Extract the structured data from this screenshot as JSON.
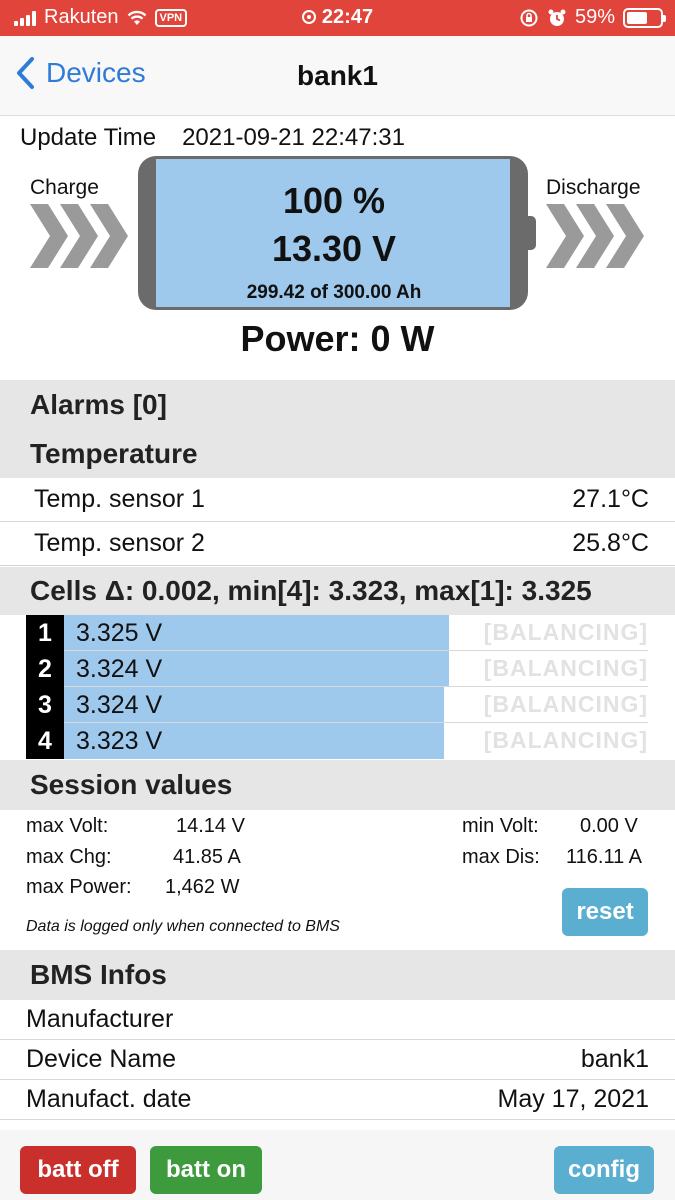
{
  "status_bar": {
    "carrier": "Rakuten",
    "vpn": "VPN",
    "time": "22:47",
    "battery_pct": "59%"
  },
  "nav": {
    "back_label": "Devices",
    "title": "bank1"
  },
  "battery": {
    "update_label": "Update Time",
    "update_value": "2021-09-21 22:47:31",
    "charge_label": "Charge",
    "discharge_label": "Discharge",
    "percent": "100 %",
    "voltage": "13.30 V",
    "capacity": "299.42 of 300.00 Ah",
    "power": "Power: 0 W",
    "fill_fraction": 1.0
  },
  "alarms": {
    "title": "Alarms [0]"
  },
  "temperature": {
    "title": "Temperature",
    "sensors": [
      {
        "label": "Temp. sensor 1",
        "value": "27.1°C"
      },
      {
        "label": "Temp. sensor 2",
        "value": "25.8°C"
      }
    ]
  },
  "cells": {
    "title": "Cells Δ: 0.002, min[4]: 3.323, max[1]: 3.325",
    "items": [
      {
        "num": "1",
        "voltage": "3.325 V",
        "status": "[BALANCING]",
        "level": 0.66
      },
      {
        "num": "2",
        "voltage": "3.324 V",
        "status": "[BALANCING]",
        "level": 0.66
      },
      {
        "num": "3",
        "voltage": "3.324 V",
        "status": "[BALANCING]",
        "level": 0.65
      },
      {
        "num": "4",
        "voltage": "3.323 V",
        "status": "[BALANCING]",
        "level": 0.65
      }
    ]
  },
  "session": {
    "title": "Session values",
    "max_volt_label": "max Volt:",
    "max_volt": "14.14 V",
    "max_chg_label": "max Chg:",
    "max_chg": "41.85 A",
    "max_power_label": "max Power:",
    "max_power": "1,462 W",
    "min_volt_label": "min Volt:",
    "min_volt": "0.00 V",
    "max_dis_label": "max Dis:",
    "max_dis": "116.11 A",
    "note": "Data is logged only when connected to BMS",
    "reset_label": "reset"
  },
  "bms": {
    "title": "BMS Infos",
    "rows": [
      {
        "label": "Manufacturer",
        "value": ""
      },
      {
        "label": "Device Name",
        "value": "bank1"
      },
      {
        "label": "Manufact. date",
        "value": "May 17, 2021"
      }
    ]
  },
  "toolbar": {
    "batt_off_label": "batt off",
    "batt_on_label": "batt on",
    "config_label": "config"
  },
  "colors": {
    "status_bar": "#e0443a",
    "accent_blue": "#2f7bd8",
    "battery_fill": "#9ec8ec",
    "btn_off": "#c9302c",
    "btn_on": "#3d9a3d",
    "btn_info": "#5aaed0"
  }
}
